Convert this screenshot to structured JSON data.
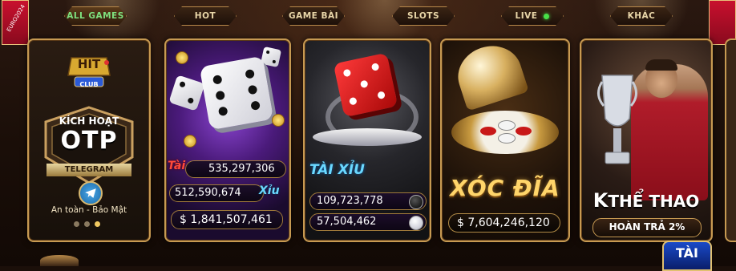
{
  "tabs": [
    {
      "label": "ALL GAMES",
      "active": true
    },
    {
      "label": "HOT",
      "active": false
    },
    {
      "label": "GAME BÀI",
      "active": false
    },
    {
      "label": "SLOTS",
      "active": false
    },
    {
      "label": "LIVE",
      "active": false,
      "live_indicator": true
    },
    {
      "label": "KHÁC",
      "active": false
    }
  ],
  "ribbon_left": {
    "text": "EURO2024"
  },
  "cards": {
    "hit_club": {
      "logo_top": "HIT",
      "logo_bottom": "CLUB",
      "title": "KÍCH HOẠT",
      "main": "OTP",
      "channel": "TELEGRAM",
      "caption": "An toàn - Bảo Mật",
      "carousel_active_index": 2
    },
    "tai_xiu_dice": {
      "tai_label": "Tài",
      "tai_value": "535,297,306",
      "xiu_label": "Xỉu",
      "xiu_value": "512,590,674",
      "total": "$ 1,841,507,461"
    },
    "tai_xiu_red": {
      "title": "TÀI XỈU",
      "value_1": "109,723,778",
      "value_2": "57,504,462"
    },
    "xoc_dia": {
      "title": "XÓC ĐĨA",
      "total": "$ 7,604,246,120"
    },
    "the_thao": {
      "prefix": "K",
      "title": "THỂ THAO",
      "subtitle": "HOÀN TRẢ 2%"
    }
  },
  "floating_badge": {
    "label": "TÀI"
  },
  "colors": {
    "gold_border": "#c79a52",
    "active_tab_text": "#7ee07e",
    "live_dot": "#48e048",
    "xoc_dia_gold": "#ffd56a",
    "tai_xiu_blue": "#6ad8ff"
  }
}
